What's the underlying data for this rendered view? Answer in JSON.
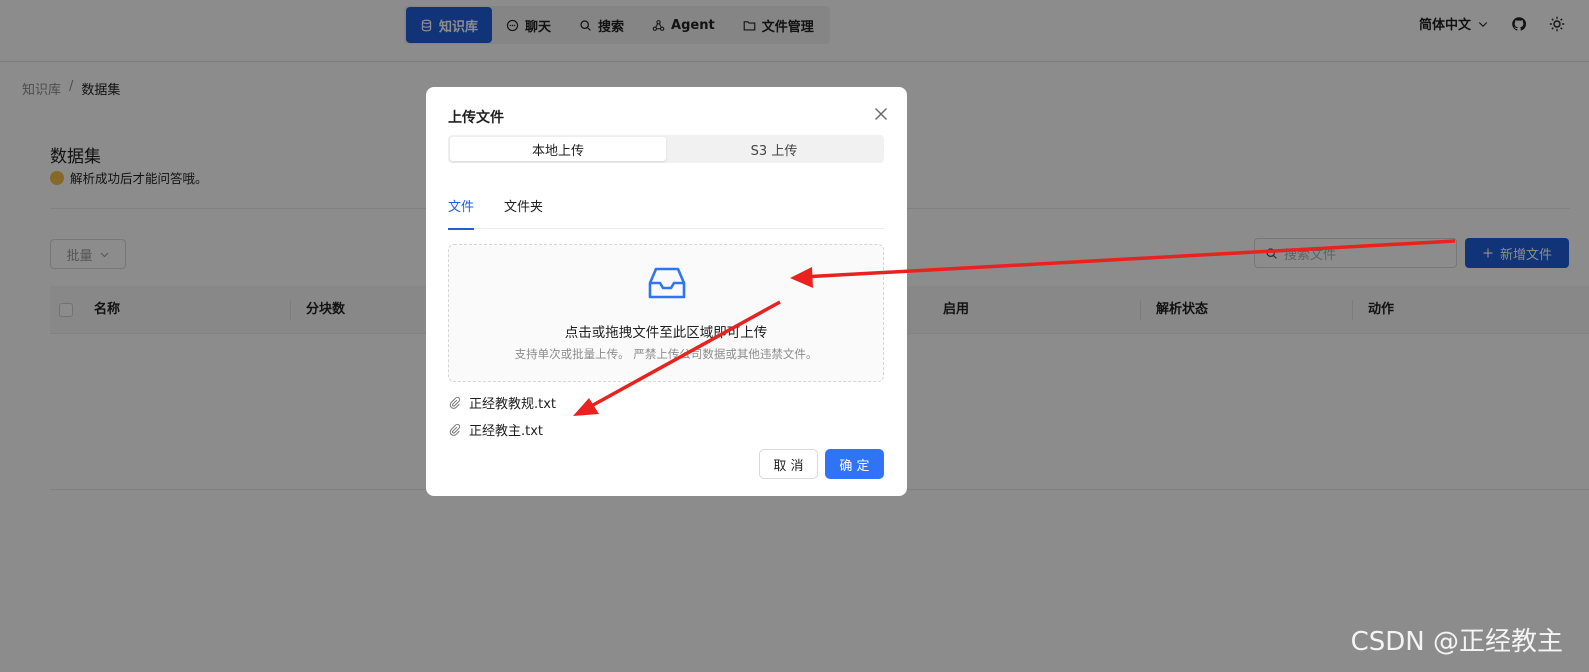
{
  "nav": {
    "items": [
      {
        "label": "知识库",
        "icon": "database-icon",
        "active": true
      },
      {
        "label": "聊天",
        "icon": "chat-icon",
        "active": false
      },
      {
        "label": "搜索",
        "icon": "search-icon",
        "active": false
      },
      {
        "label": "Agent",
        "icon": "agent-icon",
        "active": false
      },
      {
        "label": "文件管理",
        "icon": "folder-icon",
        "active": false
      }
    ],
    "language": "简体中文"
  },
  "breadcrumb": {
    "root": "知识库",
    "separator": "/",
    "current": "数据集"
  },
  "page": {
    "title": "数据集",
    "hint": "解析成功后才能问答哦。",
    "batch_label": "批量",
    "search_placeholder": "搜索文件",
    "add_label": "新增文件"
  },
  "table": {
    "columns": [
      "名称",
      "分块数",
      "启用",
      "解析状态",
      "动作"
    ]
  },
  "modal": {
    "title": "上传文件",
    "segments": [
      "本地上传",
      "S3 上传"
    ],
    "tabs": [
      "文件",
      "文件夹"
    ],
    "drop_text": "点击或拖拽文件至此区域即可上传",
    "drop_hint": "支持单次或批量上传。 严禁上传公司数据或其他违禁文件。",
    "files": [
      "正经教教规.txt",
      "正经教主.txt"
    ],
    "cancel_label": "取 消",
    "ok_label": "确 定"
  },
  "watermark": "CSDN @正经教主",
  "colors": {
    "primary": "#1f5fdb",
    "ok_button": "#2f73f6",
    "annotation_arrow": "#e8231f"
  }
}
